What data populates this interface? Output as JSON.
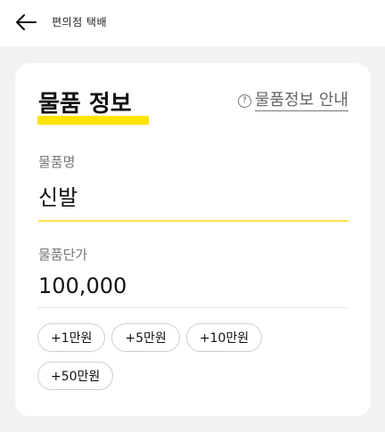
{
  "header": {
    "back_icon": "arrow-left-icon",
    "title": "편의점 택배"
  },
  "item_info": {
    "title": "물품 정보",
    "highlight_color": "#ffe500",
    "guide_icon": "question-circle-icon",
    "guide_link": "물품정보 안내",
    "name_label": "물품명",
    "name_value": "신발",
    "price_label": "물품단가",
    "price_value": "100,000",
    "quick_amounts": [
      "+1만원",
      "+5만원",
      "+10만원",
      "+50만원"
    ]
  }
}
